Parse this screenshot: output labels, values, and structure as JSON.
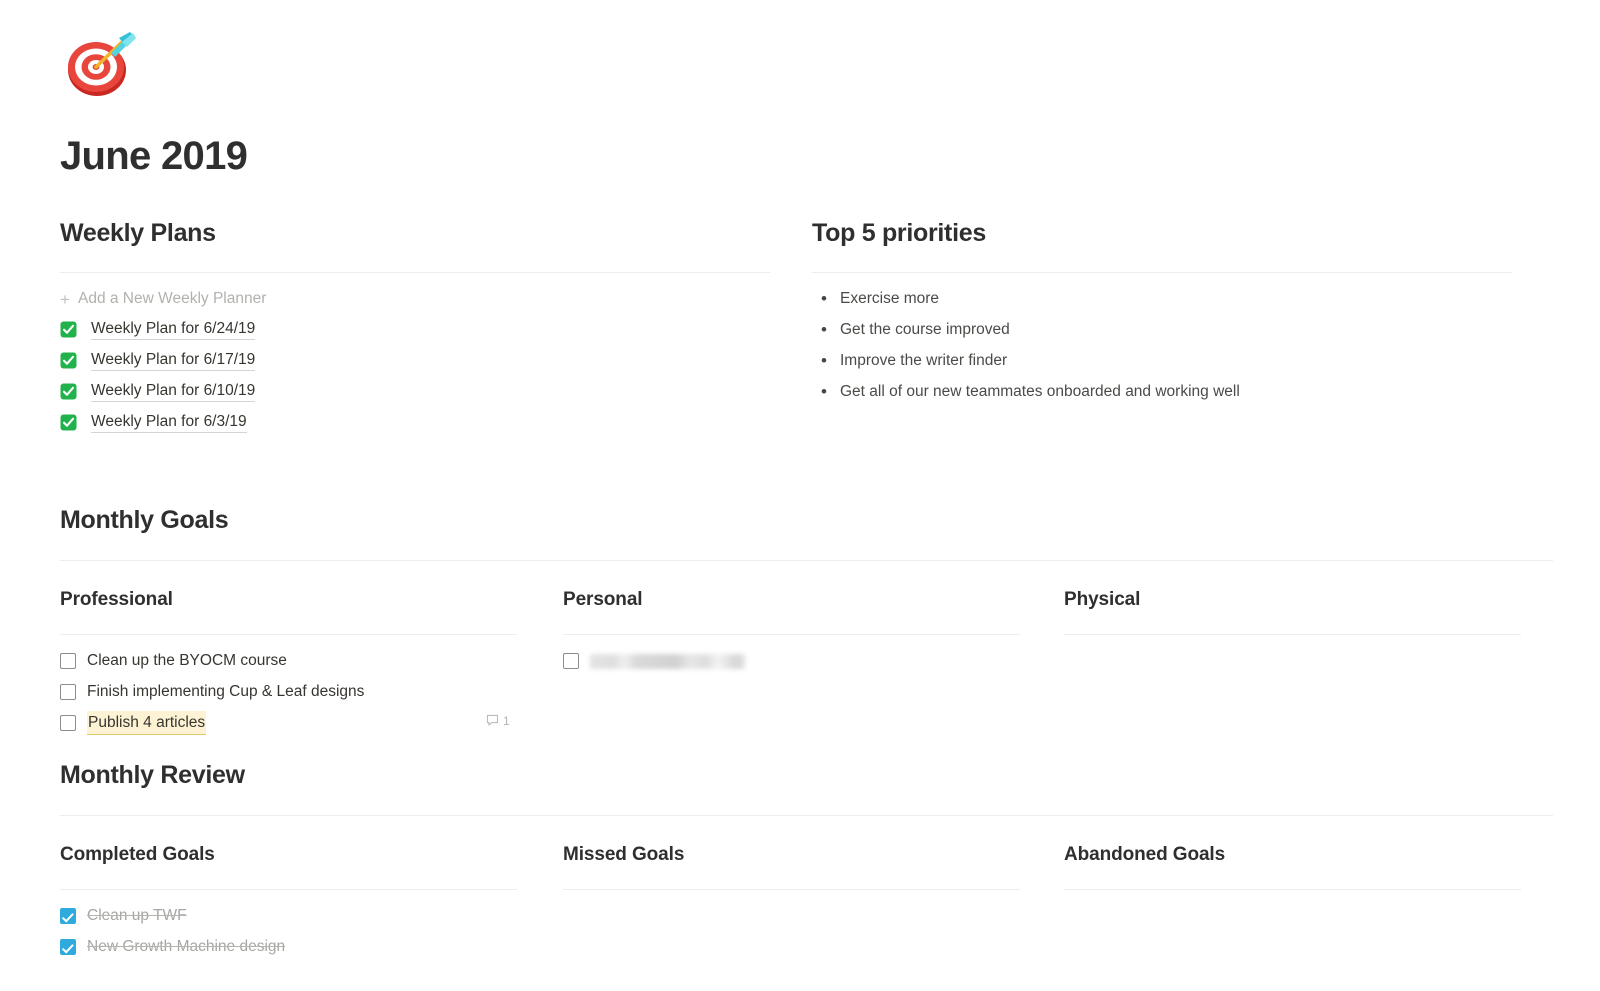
{
  "page": {
    "icon": "dart-target-emoji",
    "title": "June 2019"
  },
  "weekly_plans": {
    "heading": "Weekly Plans",
    "add_icon": "plus-icon",
    "add_label": "Add a New Weekly Planner",
    "items": [
      {
        "icon": "green-check-emoji",
        "label": "Weekly Plan for 6/24/19"
      },
      {
        "icon": "green-check-emoji",
        "label": "Weekly Plan for 6/17/19"
      },
      {
        "icon": "green-check-emoji",
        "label": "Weekly Plan for 6/10/19"
      },
      {
        "icon": "green-check-emoji",
        "label": "Weekly Plan for 6/3/19"
      }
    ]
  },
  "priorities": {
    "heading": "Top 5 priorities",
    "items": [
      "Exercise more",
      "Get the course improved",
      "Improve the writer finder",
      "Get all of our new teammates onboarded and working well"
    ]
  },
  "monthly_goals": {
    "heading": "Monthly Goals",
    "columns": [
      {
        "title": "Professional",
        "tasks": [
          {
            "label": "Clean up the BYOCM course",
            "checked": false,
            "style": "plain"
          },
          {
            "label": "Finish implementing Cup & Leaf designs",
            "checked": false,
            "style": "plain"
          },
          {
            "label": "Publish 4 articles",
            "checked": false,
            "style": "highlight",
            "comment_count": "1",
            "comment_icon": "comment-bubble-icon"
          }
        ]
      },
      {
        "title": "Personal",
        "tasks": [
          {
            "label": "",
            "checked": false,
            "style": "blurred"
          }
        ]
      },
      {
        "title": "Physical",
        "tasks": []
      }
    ]
  },
  "monthly_review": {
    "heading": "Monthly Review",
    "columns": [
      {
        "title": "Completed Goals",
        "tasks": [
          {
            "label": "Clean up TWF",
            "checked": true,
            "style": "done"
          },
          {
            "label": "New Growth Machine design",
            "checked": true,
            "style": "done"
          }
        ]
      },
      {
        "title": "Missed Goals",
        "tasks": []
      },
      {
        "title": "Abandoned Goals",
        "tasks": []
      }
    ]
  },
  "colors": {
    "accent_checkbox": "#2eaadc",
    "highlight": "#fdf3d4",
    "text": "#37352f",
    "muted": "#b3b1ac",
    "divider": "#ededec"
  }
}
